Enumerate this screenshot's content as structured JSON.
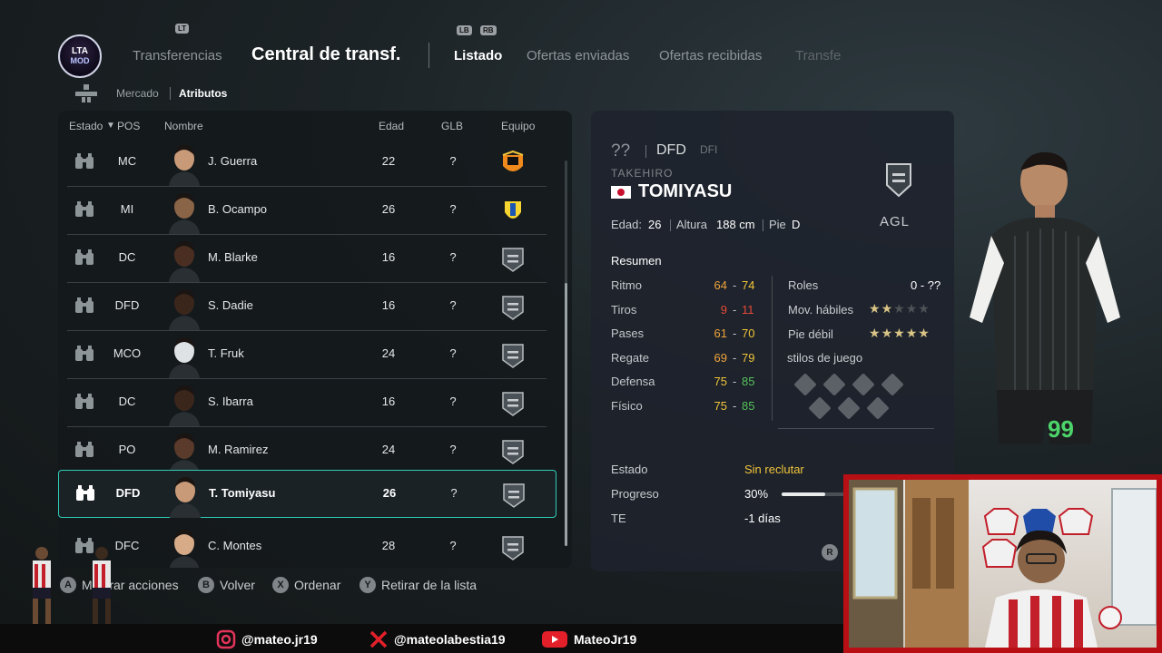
{
  "nav": {
    "logo_top": "LTA",
    "logo_bottom": "MOD",
    "lt": "LT",
    "lb": "LB",
    "rb": "RB",
    "transferencias": "Transferencias",
    "title": "Central de transf.",
    "tabs": [
      "Listado",
      "Ofertas enviadas",
      "Ofertas recibidas",
      "Transfe"
    ]
  },
  "subnav": {
    "mercado": "Mercado",
    "atributos": "Atributos"
  },
  "table": {
    "headers": {
      "estado": "Estado",
      "pos": "POS",
      "nombre": "Nombre",
      "edad": "Edad",
      "glb": "GLB",
      "equipo": "Equipo"
    },
    "rows": [
      {
        "pos": "MC",
        "name": "J. Guerra",
        "age": "22",
        "glb": "?",
        "team": "valencia-crest"
      },
      {
        "pos": "MI",
        "name": "B. Ocampo",
        "age": "26",
        "glb": "?",
        "team": "cadiz-crest"
      },
      {
        "pos": "DC",
        "name": "M. Blarke",
        "age": "16",
        "glb": "?",
        "team": "club-crest"
      },
      {
        "pos": "DFD",
        "name": "S. Dadie",
        "age": "16",
        "glb": "?",
        "team": "club-crest"
      },
      {
        "pos": "MCO",
        "name": "T. Fruk",
        "age": "24",
        "glb": "?",
        "team": "club-crest"
      },
      {
        "pos": "DC",
        "name": "S. Ibarra",
        "age": "16",
        "glb": "?",
        "team": "club-crest"
      },
      {
        "pos": "PO",
        "name": "M. Ramirez",
        "age": "24",
        "glb": "?",
        "team": "club-crest"
      },
      {
        "pos": "DFD",
        "name": "T. Tomiyasu",
        "age": "26",
        "glb": "?",
        "team": "club-crest",
        "selected": true
      },
      {
        "pos": "DFC",
        "name": "C. Montes",
        "age": "28",
        "glb": "?",
        "team": "club-crest"
      }
    ]
  },
  "player": {
    "rating": "??",
    "position": "DFD",
    "alt_position": "DFI",
    "first_name": "TAKEHIRO",
    "last_name": "TOMIYASU",
    "role_short": "AGL",
    "edad_label": "Edad:",
    "edad": "26",
    "altura_label": "Altura",
    "altura": "188 cm",
    "pie_label": "Pie",
    "pie": "D",
    "resumen": "Resumen",
    "stats": [
      {
        "label": "Ritmo",
        "min": "64",
        "max": "74"
      },
      {
        "label": "Tiros",
        "min": "9",
        "max": "11"
      },
      {
        "label": "Pases",
        "min": "61",
        "max": "70"
      },
      {
        "label": "Regate",
        "min": "69",
        "max": "79"
      },
      {
        "label": "Defensa",
        "min": "75",
        "max": "85"
      },
      {
        "label": "Físico",
        "min": "75",
        "max": "85"
      }
    ],
    "dash": "-",
    "roles_label": "Roles",
    "roles_value": "0 - ??",
    "skill_moves_label": "Mov. hábiles",
    "skill_moves": 2,
    "weak_foot_label": "Pie débil",
    "weak_foot": 5,
    "playstyles_label": "stilos de juego",
    "estado_label": "Estado",
    "estado_value": "Sin reclutar",
    "progreso_label": "Progreso",
    "progreso_value": "30%",
    "progreso_fraction": 0.3,
    "te_label": "TE",
    "te_value": "-1 días",
    "shirt_number": "99"
  },
  "hints": [
    {
      "key": "A",
      "label": "Mostrar acciones"
    },
    {
      "key": "B",
      "label": "Volver"
    },
    {
      "key": "X",
      "label": "Ordenar"
    },
    {
      "key": "Y",
      "label": "Retirar de la lista"
    }
  ],
  "social": {
    "instagram": "@mateo.jr19",
    "x": "@mateolabestia19",
    "youtube": "MateoJr19"
  },
  "colors": {
    "accent": "#2fcdb8",
    "cam_border": "#b80f15"
  }
}
